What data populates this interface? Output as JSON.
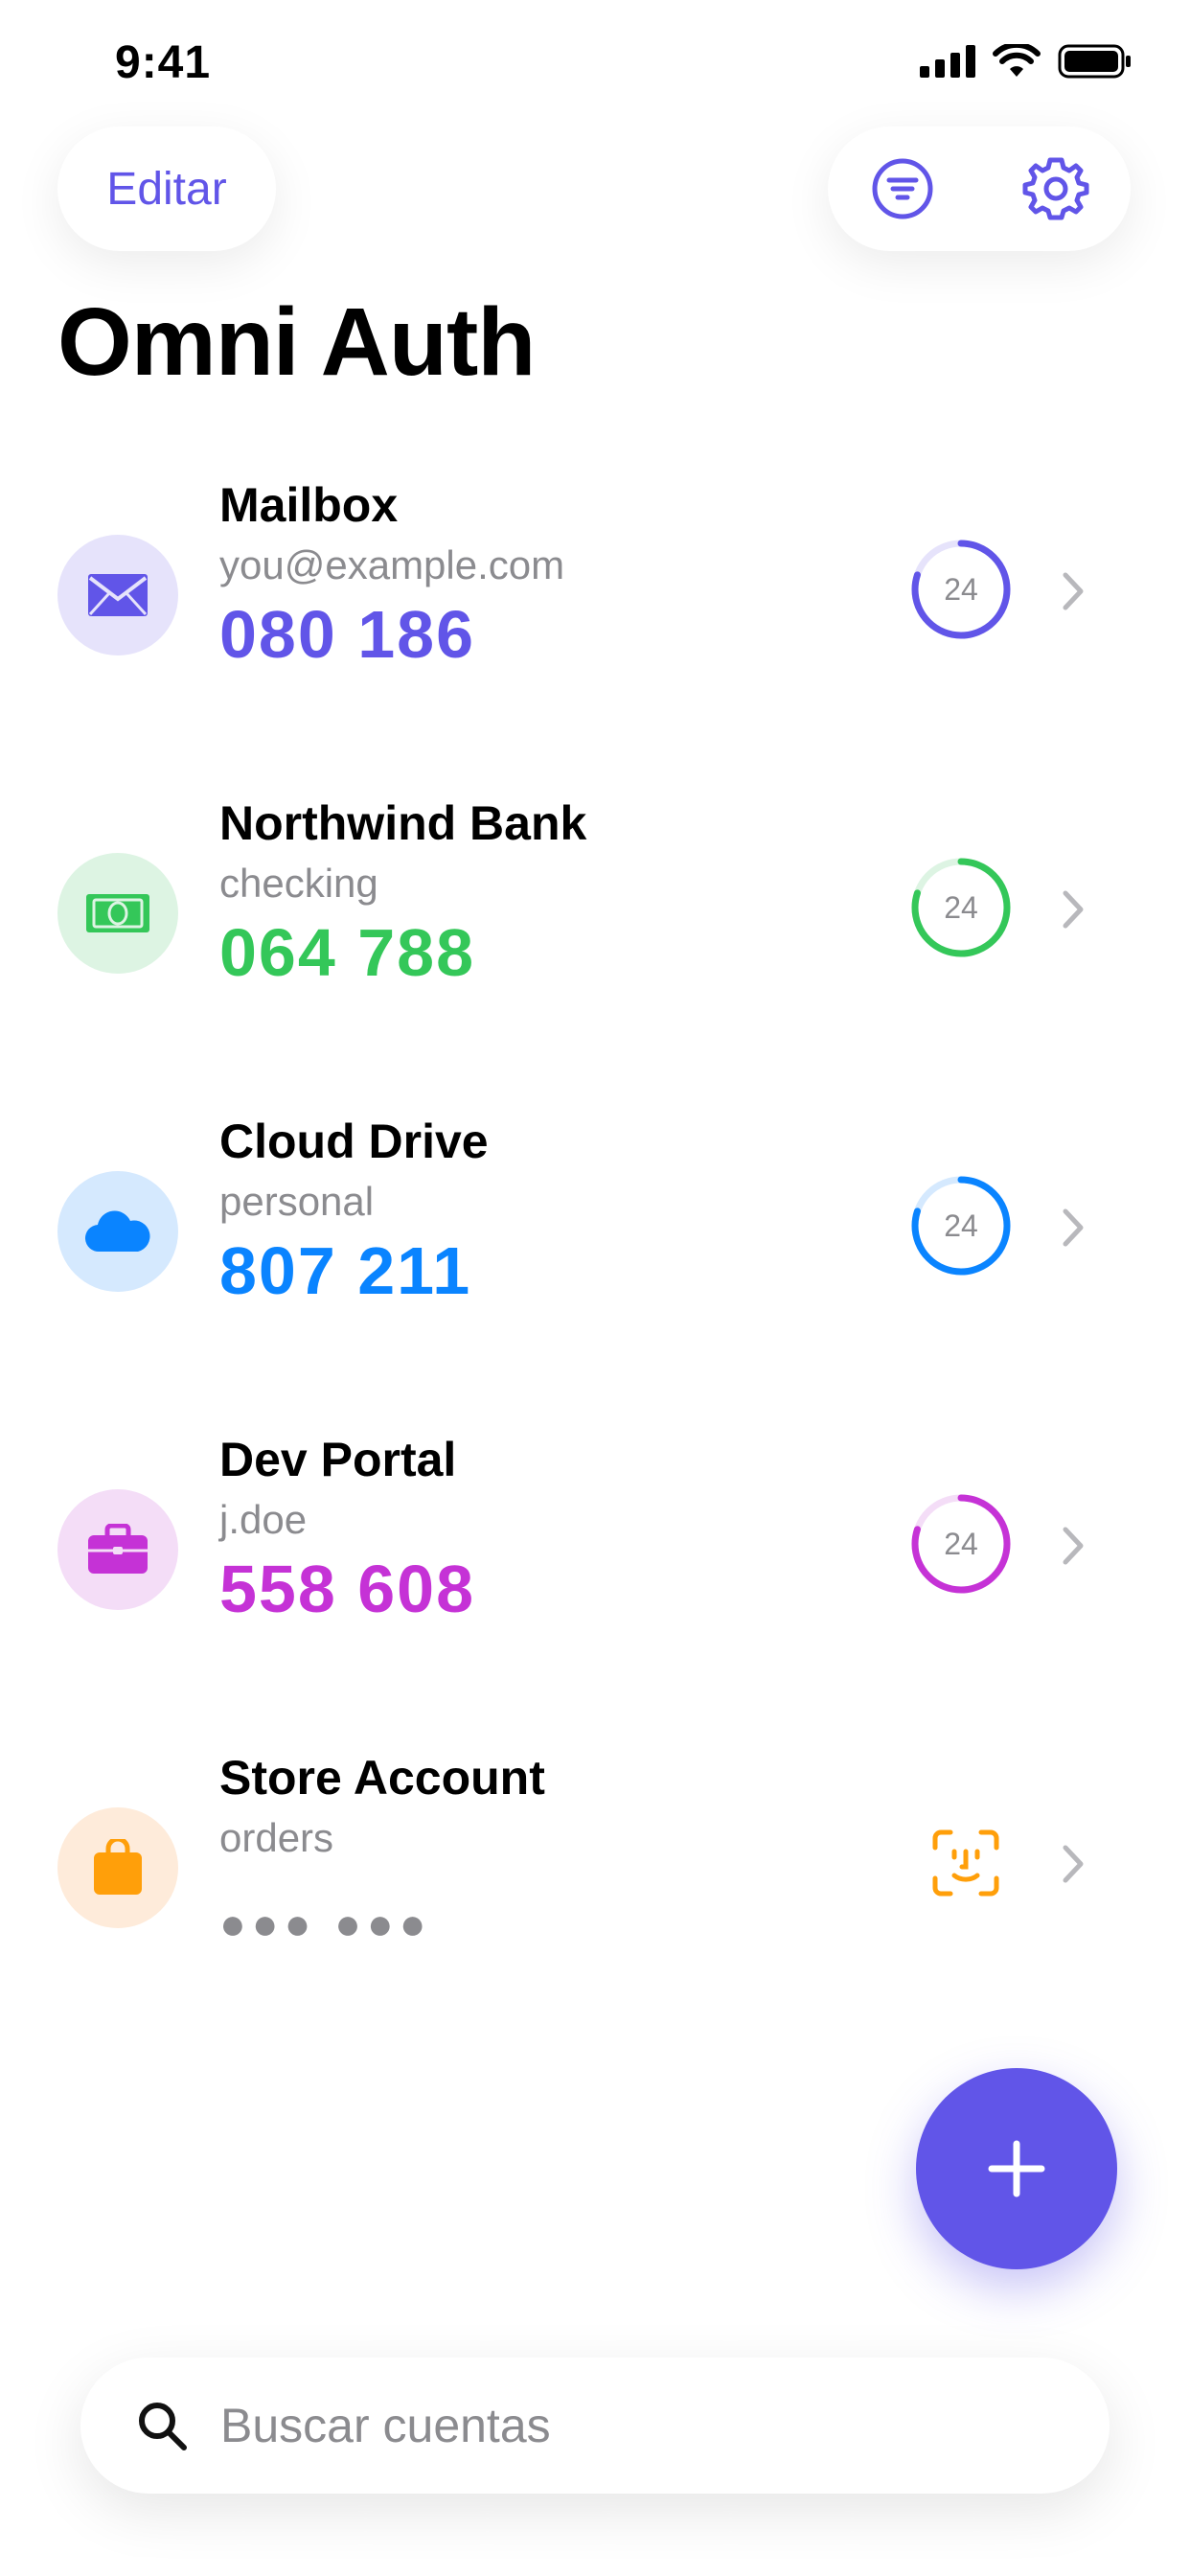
{
  "status_bar": {
    "time": "9:41"
  },
  "header": {
    "edit_label": "Editar",
    "title": "Omni Auth"
  },
  "accounts": [
    {
      "name": "Mailbox",
      "subtitle": "you@example.com",
      "code": "080 186",
      "timer": "24",
      "color": "#6155E8",
      "icon_bg": "#E6E3FB",
      "icon": "envelope-icon",
      "timer_progress": 0.8
    },
    {
      "name": "Northwind Bank",
      "subtitle": "checking",
      "code": "064 788",
      "timer": "24",
      "color": "#34C759",
      "icon_bg": "#DDF4E3",
      "icon": "banknote-icon",
      "timer_progress": 0.8
    },
    {
      "name": "Cloud Drive",
      "subtitle": "personal",
      "code": "807 211",
      "timer": "24",
      "color": "#0A84FF",
      "icon_bg": "#D5E9FE",
      "icon": "cloud-icon",
      "timer_progress": 0.8
    },
    {
      "name": "Dev Portal",
      "subtitle": "j.doe",
      "code": "558 608",
      "timer": "24",
      "color": "#C532D6",
      "icon_bg": "#F4DDF7",
      "icon": "briefcase-icon",
      "timer_progress": 0.8
    },
    {
      "name": "Store Account",
      "subtitle": "orders",
      "code": "●●● ●●●",
      "color": "#FF9F0A",
      "icon_bg": "#FEEBDA",
      "icon": "shopping-bag-icon",
      "locked": true
    }
  ],
  "search": {
    "placeholder": "Buscar cuentas"
  },
  "colors": {
    "accent": "#6155E8",
    "secondary_text": "#8b8b8f"
  }
}
